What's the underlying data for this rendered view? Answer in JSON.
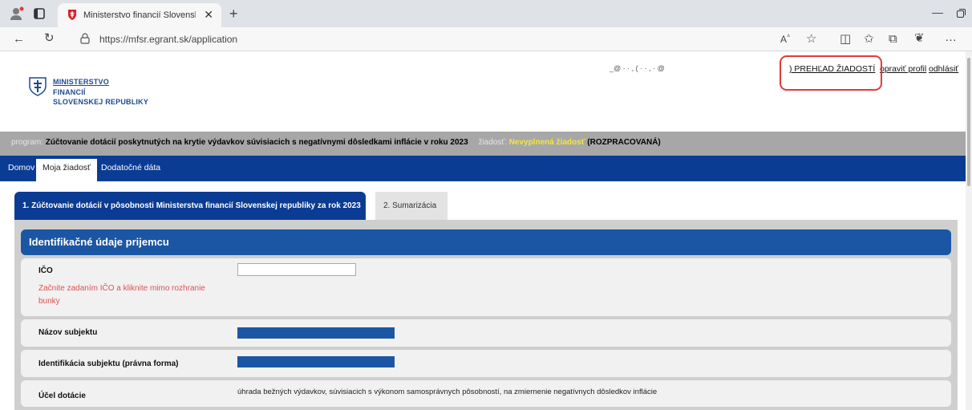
{
  "browser": {
    "tab_title": "Ministerstvo financií Slovenskej r",
    "url": "https://mfsr.egrant.sk/application",
    "icons": [
      "profile-icon",
      "tab-list-icon",
      "shield-favicon-icon",
      "close-icon",
      "new-tab-icon",
      "back-icon",
      "refresh-icon",
      "lock-icon",
      "read-aloud-icon",
      "favorite-icon",
      "split-screen-icon",
      "favorites-list-icon",
      "collections-icon",
      "extensions-icon",
      "more-icon",
      "minimize-icon",
      "restore-icon"
    ]
  },
  "header": {
    "logo_lines": [
      "MINISTERSTVO",
      "FINANCIÍ",
      "SLOVENSKEJ REPUBLIKY"
    ],
    "user_email": "_@ ·  ·  , ( ·  ·  ,  ·  @",
    "links": {
      "overview": ") PREHĽAD ŽIADOSTÍ",
      "edit_profile": "opraviť profil",
      "logout": "odhlásiť"
    }
  },
  "program_bar": {
    "program_label": "program:",
    "program_value": "Zúčtovanie dotácií poskytnutých na krytie výdavkov súvisiacich s negatívnymi dôsledkami inflácie v roku 2023",
    "request_label": "žiadosť:",
    "request_value": "Nevyplnená žiadosť",
    "status": "(ROZPRACOVANÁ)"
  },
  "nav": {
    "items": [
      "Domov",
      "Moja žiadosť",
      "Dodatočné dáta"
    ]
  },
  "section_tabs": [
    "1. Zúčtovanie dotácií v pôsobnosti Ministerstva financií Slovenskej republiky za rok 2023",
    "2. Sumarizácia"
  ],
  "panel": {
    "title": "Identifikačné údaje prijemcu",
    "rows": {
      "ico_label": "IČO",
      "ico_hint": "Začnite zadaním IČO a kliknite mimo rozhranie bunky",
      "ico_value": "",
      "subject_name_label": "Názov subjektu",
      "subject_id_label": "Identifikácia subjektu (právna forma)",
      "purpose_label": "Účel dotácie",
      "purpose_value": "úhrada bežných výdavkov, súvisiacich s výkonom samosprávnych pôsobností, na zmiernenie negatívnych dôsledkov inflácie"
    }
  },
  "colors": {
    "nav_blue": "#0b3c94",
    "header_blue": "#1b56a4",
    "gray_bar": "#a7a7a7",
    "highlight_red": "#e23a3a",
    "hint_red": "#e05050",
    "request_yellow": "#f5e53a"
  }
}
